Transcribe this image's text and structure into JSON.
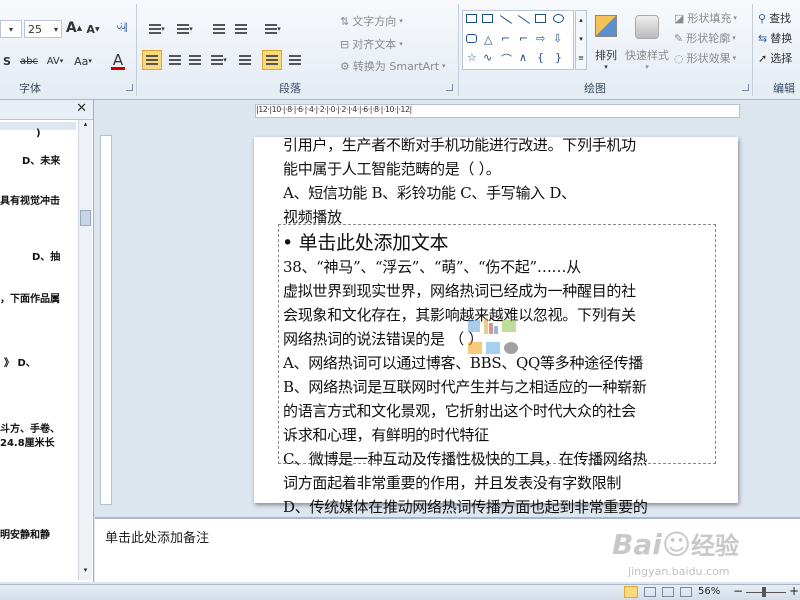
{
  "ribbon": {
    "font_group": {
      "label": "字体",
      "font_size": "25",
      "grow_icon": "A",
      "shrink_icon": "A",
      "shadow": "S",
      "strike": "abc",
      "spacing": "AV",
      "case": "Aa",
      "color": "A"
    },
    "paragraph_group": {
      "label": "段落",
      "text_direction": "文字方向",
      "align_text": "对齐文本",
      "convert_smartart": "转换为 SmartArt"
    },
    "drawing_group": {
      "label": "绘图",
      "arrange": "排列",
      "quick_styles": "快速样式",
      "shape_fill": "形状填充",
      "shape_outline": "形状轮廓",
      "shape_effects": "形状效果"
    },
    "editing_group": {
      "label": "编辑",
      "find": "查找",
      "replace": "替换",
      "select": "选择"
    }
  },
  "outline": {
    "lines": [
      ")",
      "D、未来",
      "具有视觉冲击",
      "D、抽",
      "，下面作品属",
      "》    D、",
      "斗方、手卷、",
      "24.8厘米长",
      "明安静和静"
    ]
  },
  "slide": {
    "lines_top": [
      "引用户，生产者不断对手机功能进行改进。下列手机功",
      "能中属于人工智能范畴的是（    ）。",
      "  A、短信功能    B、彩铃功能     C、手写输入     D、",
      "视频播放"
    ],
    "bullet_placeholder": "• 单击此处添加文本",
    "lines_body": [
      "38、“神马”、“浮云”、“萌”、“伤不起”……从",
      "虚拟世界到现实世界，网络热词已经成为一种醒目的社",
      "会现象和文化存在，其影响越来越难以忽视。下列有关",
      "网络热词的说法错误的是                  （     ）",
      "A、网络热词可以通过博客、BBS、QQ等多种途径传播",
      "B、网络热词是互联网时代产生并与之相适应的一种崭新",
      "的语言方式和文化景观，它折射出这个时代大众的社会",
      "诉求和心理，有鲜明的时代特征",
      "C、微博是一种互动及传播性极快的工具，在传播网络热",
      "词方面起着非常重要的作用，并且发表没有字数限制",
      "D、传统媒体在推动网络热词传播方面也起到非常重要的"
    ]
  },
  "ruler_text": "|12·|10·|·8·|·6·|·4·|·2·|·0·|·2·|·4·|·6·|·8·|·10·|·12|",
  "notes": {
    "placeholder": "单击此处添加备注"
  },
  "statusbar": {
    "zoom": "56%",
    "minus": "−",
    "plus": "+"
  },
  "watermark": {
    "brand": "Bai",
    "brand2": "经验",
    "url": "jingyan.baidu.com"
  },
  "colors": {
    "accent": "#f5c64a",
    "text_color_bar": "#d40000",
    "ribbon_border": "#aab9cf"
  }
}
